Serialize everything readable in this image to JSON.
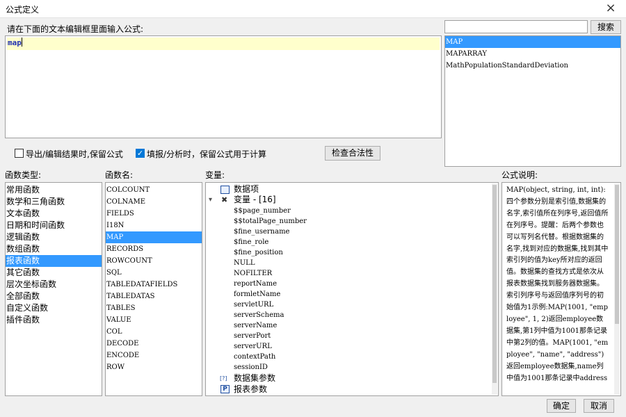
{
  "window": {
    "title": "公式定义",
    "close_icon": "×"
  },
  "editor": {
    "label": "请在下面的文本编辑框里面输入公式:",
    "value": "map"
  },
  "search": {
    "placeholder": "",
    "button_label": "搜索",
    "results": [
      "MAP",
      "MAPARRAY",
      "MathPopulationStandardDeviation"
    ],
    "selected_index": 0
  },
  "options": {
    "keep_on_export_label": "导出/编辑结果时,保留公式",
    "keep_on_export_checked": false,
    "keep_on_fill_label": "填报/分析时，保留公式用于计算",
    "keep_on_fill_checked": true,
    "check_button_label": "检查合法性",
    "check_mark": "✓"
  },
  "function_types": {
    "header": "函数类型:",
    "items": [
      "常用函数",
      "数学和三角函数",
      "文本函数",
      "日期和时间函数",
      "逻辑函数",
      "数组函数",
      "报表函数",
      "其它函数",
      "层次坐标函数",
      "全部函数",
      "自定义函数",
      "插件函数"
    ],
    "selected_index": 6
  },
  "function_names": {
    "header": "函数名:",
    "items": [
      "COLCOUNT",
      "COLNAME",
      "FIELDS",
      "I18N",
      "MAP",
      "RECORDS",
      "ROWCOUNT",
      "SQL",
      "TABLEDATAFIELDS",
      "TABLEDATAS",
      "TABLES",
      "VALUE",
      "COL",
      "DECODE",
      "ENCODE",
      "ROW"
    ],
    "selected_index": 4
  },
  "variables": {
    "header": "变量:",
    "data_items_label": "数据项",
    "variables_label": "变量 - [16]",
    "expand_icon": "▾",
    "variable_icon": "✖",
    "params_icon_label": "[?]",
    "report_params_icon_label": "P",
    "children": [
      "$$page_number",
      "$$totalPage_number",
      "$fine_username",
      "$fine_role",
      "$fine_position",
      "NULL",
      "NOFILTER",
      "reportName",
      "formletName",
      "servletURL",
      "serverSchema",
      "serverName",
      "serverPort",
      "serverURL",
      "contextPath",
      "sessionID"
    ],
    "dataset_params_label": "数据集参数",
    "report_params_label": "报表参数"
  },
  "description": {
    "header": "公式说明:",
    "text": "MAP(object, string, int, int):四个参数分别是索引值,数据集的名字,索引值所在列序号,返回值所在列序号。提醒：后两个参数也可以写列名代替。根据数据集的名字,找到对应的数据集,找到其中索引列的值为key所对应的返回值。数据集的查找方式是依次从报表数据集找到服务器数据集。索引列序号与返回值序列号的初始值为1示例:MAP(1001, \"employee\", 1, 2)返回employee数据集,第1列中值为1001那条记录中第2列的值。MAP(1001, \"employee\", \"name\", \"address\")返回employee数据集,name列中值为1001那条记录中address"
  },
  "footer": {
    "ok_label": "确定",
    "cancel_label": "取消"
  },
  "colors": {
    "selection": "#3399ff",
    "editor_bg": "#ffffcc",
    "editor_text": "#1f2fb0"
  }
}
